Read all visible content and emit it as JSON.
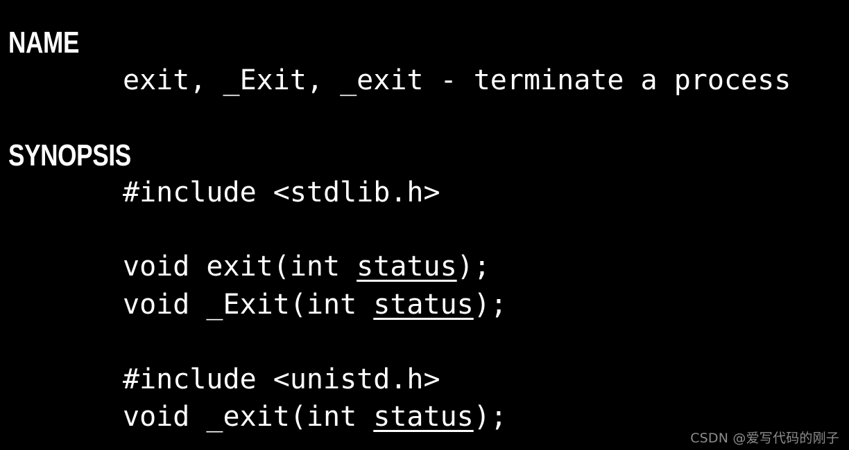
{
  "page": {
    "background_color": "#000000",
    "text_color": "#ffffff",
    "watermark_color": "#8c8c8c"
  },
  "manpage": {
    "sections": {
      "name": {
        "heading": "NAME",
        "body": "exit, _Exit, _exit - terminate a process"
      },
      "synopsis": {
        "heading": "SYNOPSIS",
        "include_stdlib": "#include <stdlib.h>",
        "decl_exit": {
          "prefix": "void exit(int ",
          "param": "status",
          "suffix": ");"
        },
        "decl_capital_exit": {
          "prefix": "void _Exit(int ",
          "param": "status",
          "suffix": ");"
        },
        "include_unistd": "#include <unistd.h>",
        "decl_underscore_exit": {
          "prefix": "void _exit(int ",
          "param": "status",
          "suffix": ");"
        }
      }
    }
  },
  "watermark": {
    "text": "CSDN @爱写代码的刚子"
  }
}
